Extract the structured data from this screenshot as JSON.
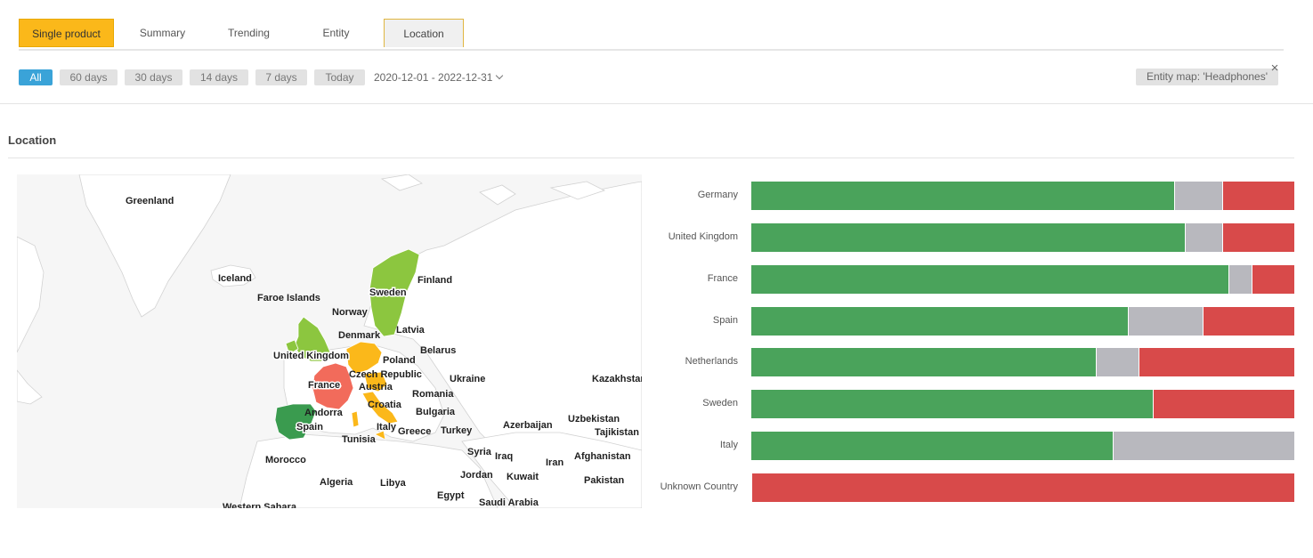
{
  "tabs": [
    {
      "label": "Single product"
    },
    {
      "label": "Summary"
    },
    {
      "label": "Trending"
    },
    {
      "label": "Entity"
    },
    {
      "label": "Location"
    }
  ],
  "filters": {
    "ranges": [
      "All",
      "60 days",
      "30 days",
      "14 days",
      "7 days",
      "Today"
    ],
    "selected_range": "All",
    "date_range": "2020-12-01 - 2022-12-31",
    "entity_filter": "Entity map: 'Headphones'"
  },
  "section": {
    "title": "Location"
  },
  "map": {
    "labels": [
      "Greenland",
      "Iceland",
      "Faroe Islands",
      "Norway",
      "Sweden",
      "Finland",
      "Denmark",
      "Latvia",
      "United Kingdom",
      "Belarus",
      "Poland",
      "Czech Republic",
      "France",
      "Austria",
      "Ukraine",
      "Kazakhstan",
      "Romania",
      "Croatia",
      "Andorra",
      "Bulgaria",
      "Spain",
      "Italy",
      "Uzbekistan",
      "Tajikistan",
      "Greece",
      "Turkey",
      "Azerbaijan",
      "Tunisia",
      "Syria",
      "Iraq",
      "Afghanistan",
      "Iran",
      "Morocco",
      "Algeria",
      "Libya",
      "Jordan",
      "Kuwait",
      "Pakistan",
      "Egypt",
      "Saudi Arabia",
      "Western Sahara"
    ],
    "highlight_colors": {
      "Sweden": "#8cc63f",
      "United Kingdom": "#8cc63f",
      "Spain": "#3a9b4f",
      "France": "#f26b5b",
      "Poland": "#fbb81a",
      "Italy": "#fbb81a"
    }
  },
  "chart_data": {
    "type": "bar",
    "orientation": "horizontal",
    "stacked": "100%",
    "title": "",
    "categories": [
      "Germany",
      "United Kingdom",
      "France",
      "Spain",
      "Netherlands",
      "Sweden",
      "Italy",
      "Unknown Country"
    ],
    "series": [
      {
        "color": "#4aa35b",
        "values": [
          77.8,
          79.9,
          87.9,
          69.3,
          63.4,
          74.0,
          66.6,
          0
        ]
      },
      {
        "color": "#b8b8be",
        "values": [
          9.0,
          6.9,
          4.2,
          13.8,
          7.9,
          0,
          33.4,
          0
        ]
      },
      {
        "color": "#d84a4a",
        "values": [
          13.2,
          13.2,
          7.9,
          16.9,
          28.7,
          26.0,
          0,
          100
        ]
      }
    ]
  }
}
